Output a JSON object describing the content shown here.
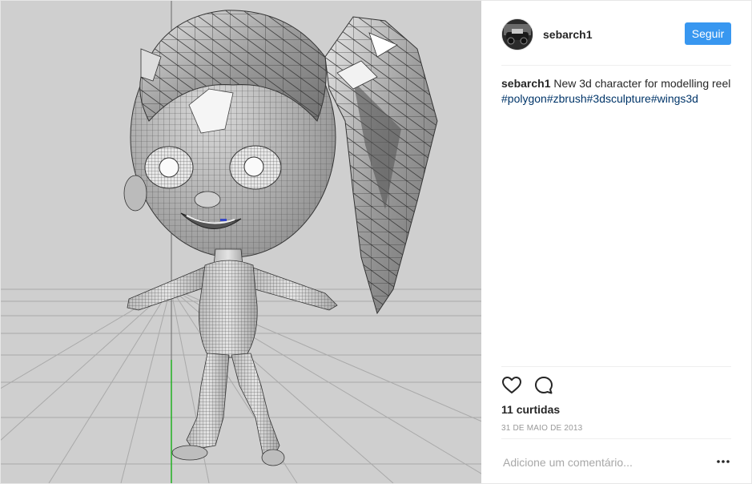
{
  "post": {
    "author": {
      "username": "sebarch1"
    },
    "follow_label": "Seguir",
    "caption": {
      "username": "sebarch1",
      "text": " New 3d character for modelling reel ",
      "hashtags": [
        "#polygon",
        "#zbrush",
        "#3dsculpture",
        "#wings3d"
      ]
    },
    "likes_label": "11 curtidas",
    "date_label": "31 DE MAIO DE 2013",
    "comment_placeholder": "Adicione um comentário...",
    "icons": {
      "like": "heart-outline-icon",
      "comment": "speech-bubble-icon",
      "more": "ellipsis-icon"
    },
    "colors": {
      "accent": "#3897f0",
      "hashtag": "#003569",
      "text": "#262626",
      "muted": "#999999",
      "media_background": "#cfcfcf"
    }
  }
}
